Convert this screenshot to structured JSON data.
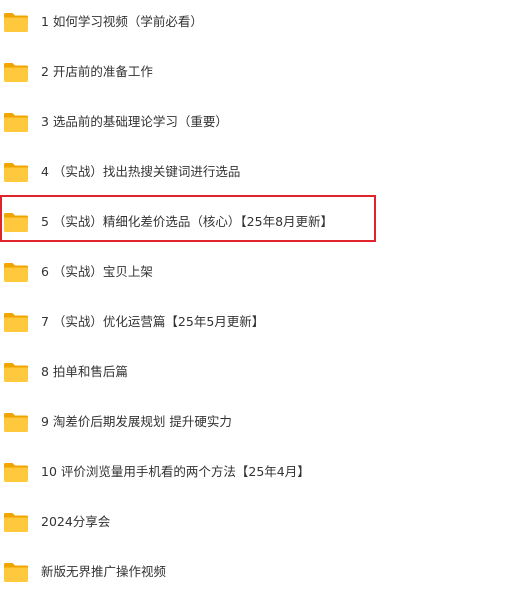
{
  "colors": {
    "folder_body": "#FFC83D",
    "folder_back": "#F0A500",
    "highlight": "#E0242B",
    "text": "#333333"
  },
  "folders": [
    {
      "label": "1 如何学习视频（学前必看）",
      "icon": "folder-icon"
    },
    {
      "label": "2 开店前的准备工作",
      "icon": "folder-icon"
    },
    {
      "label": "3 选品前的基础理论学习（重要）",
      "icon": "folder-icon"
    },
    {
      "label": "4 （实战）找出热搜关键词进行选品",
      "icon": "folder-icon"
    },
    {
      "label": "5 （实战）精细化差价选品（核心）【25年8月更新】",
      "icon": "folder-icon",
      "highlighted": true
    },
    {
      "label": "6 （实战）宝贝上架",
      "icon": "folder-icon"
    },
    {
      "label": "7 （实战）优化运营篇【25年5月更新】",
      "icon": "folder-icon"
    },
    {
      "label": "8 拍单和售后篇",
      "icon": "folder-icon"
    },
    {
      "label": "9 淘差价后期发展规划 提升硬实力",
      "icon": "folder-icon"
    },
    {
      "label": "10 评价浏览量用手机看的两个方法【25年4月】",
      "icon": "folder-icon"
    },
    {
      "label": "2024分享会",
      "icon": "folder-icon"
    },
    {
      "label": "新版无界推广操作视频",
      "icon": "folder-icon"
    }
  ]
}
